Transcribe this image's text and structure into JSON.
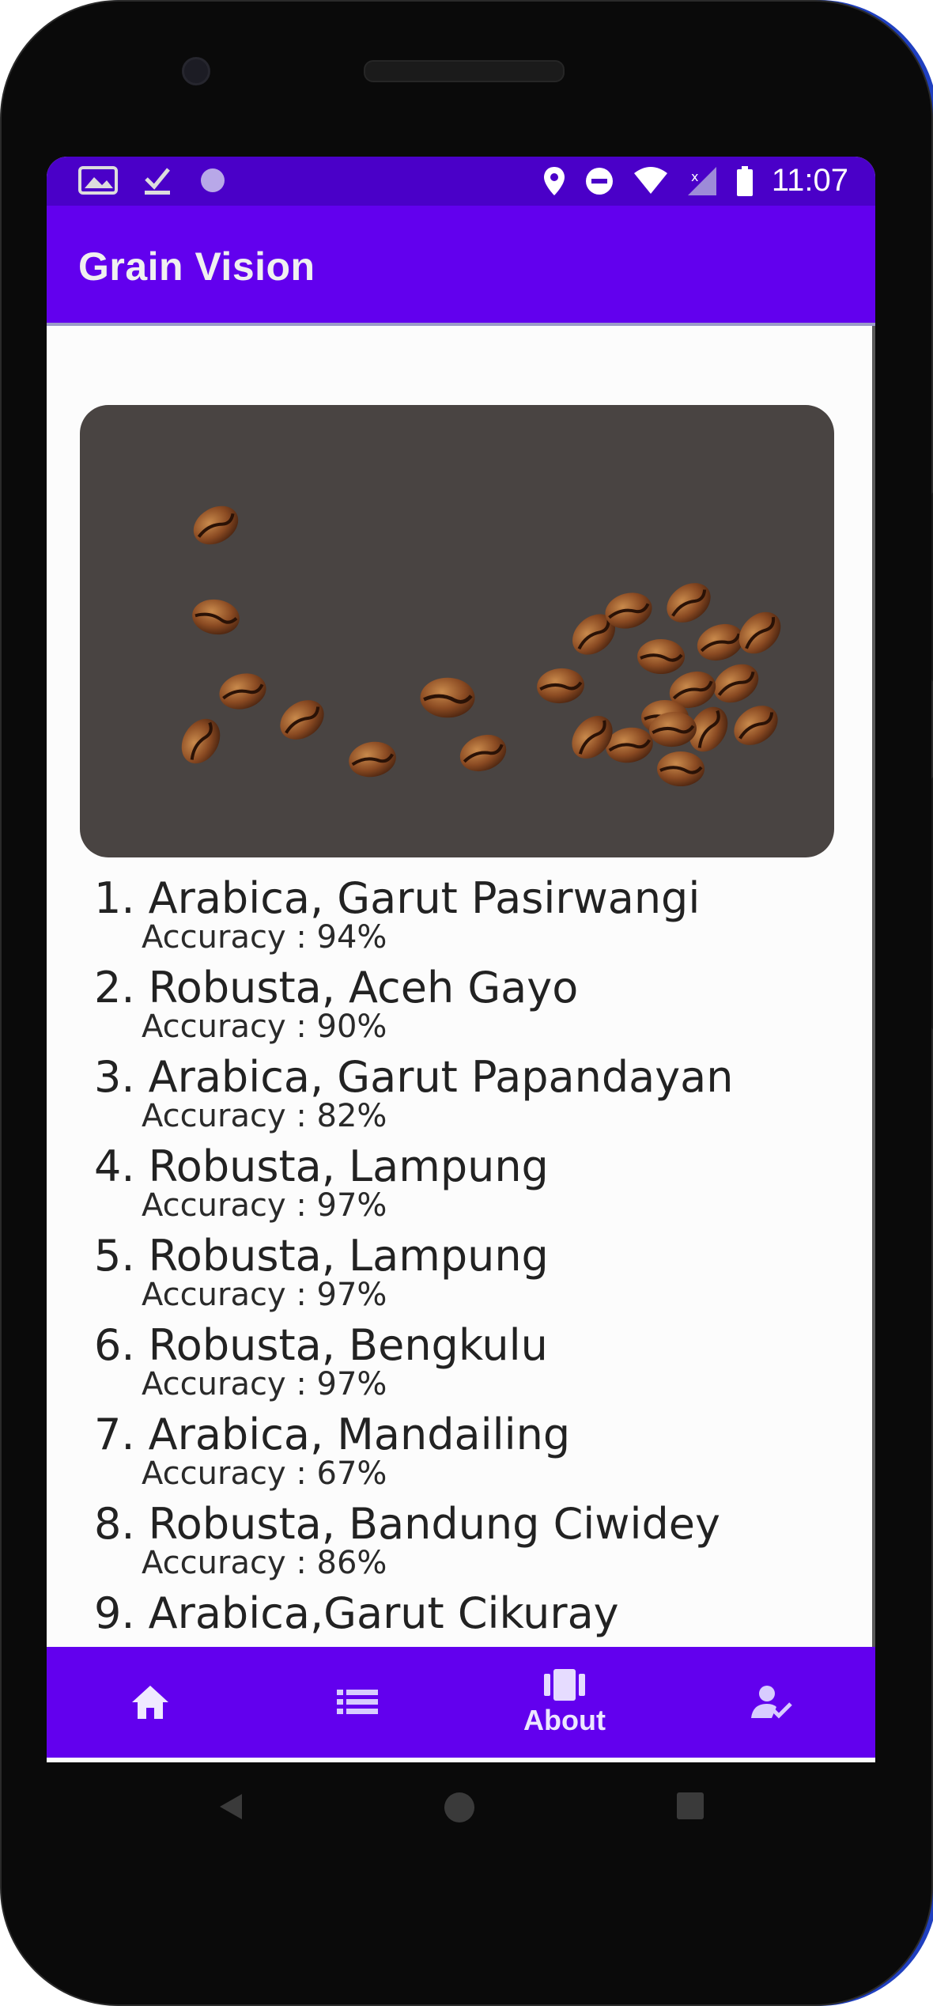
{
  "status_bar": {
    "time": "11:07",
    "left_icons": [
      "gallery-icon",
      "check-download-icon",
      "circle-notification-icon"
    ],
    "right_icons": [
      "location-icon",
      "do-not-disturb-icon",
      "wifi-icon",
      "no-signal-icon",
      "battery-icon"
    ]
  },
  "app_bar": {
    "title": "Grain Vision"
  },
  "image": {
    "description_icon": "coffee-beans-image"
  },
  "results": [
    {
      "title": "1. Arabica, Garut Pasirwangi",
      "accuracy": "Accuracy : 94%"
    },
    {
      "title": "2. Robusta, Aceh Gayo",
      "accuracy": "Accuracy : 90%"
    },
    {
      "title": "3. Arabica, Garut Papandayan",
      "accuracy": "Accuracy : 82%"
    },
    {
      "title": "4. Robusta, Lampung",
      "accuracy": "Accuracy : 97%"
    },
    {
      "title": "5. Robusta, Lampung",
      "accuracy": "Accuracy : 97%"
    },
    {
      "title": "6. Robusta, Bengkulu",
      "accuracy": "Accuracy : 97%"
    },
    {
      "title": "7. Arabica, Mandailing",
      "accuracy": "Accuracy : 67%"
    },
    {
      "title": "8. Robusta, Bandung Ciwidey",
      "accuracy": "Accuracy : 86%"
    },
    {
      "title": "9. Arabica,Garut Cikuray",
      "accuracy": ""
    }
  ],
  "bottom_nav": {
    "items": [
      {
        "icon": "home-icon",
        "label": ""
      },
      {
        "icon": "list-icon",
        "label": ""
      },
      {
        "icon": "about-icon",
        "label": "About"
      },
      {
        "icon": "user-check-icon",
        "label": ""
      }
    ]
  },
  "colors": {
    "primary": "#6200ee",
    "primary_dark": "#4a00c8",
    "image_bg": "#494442"
  }
}
